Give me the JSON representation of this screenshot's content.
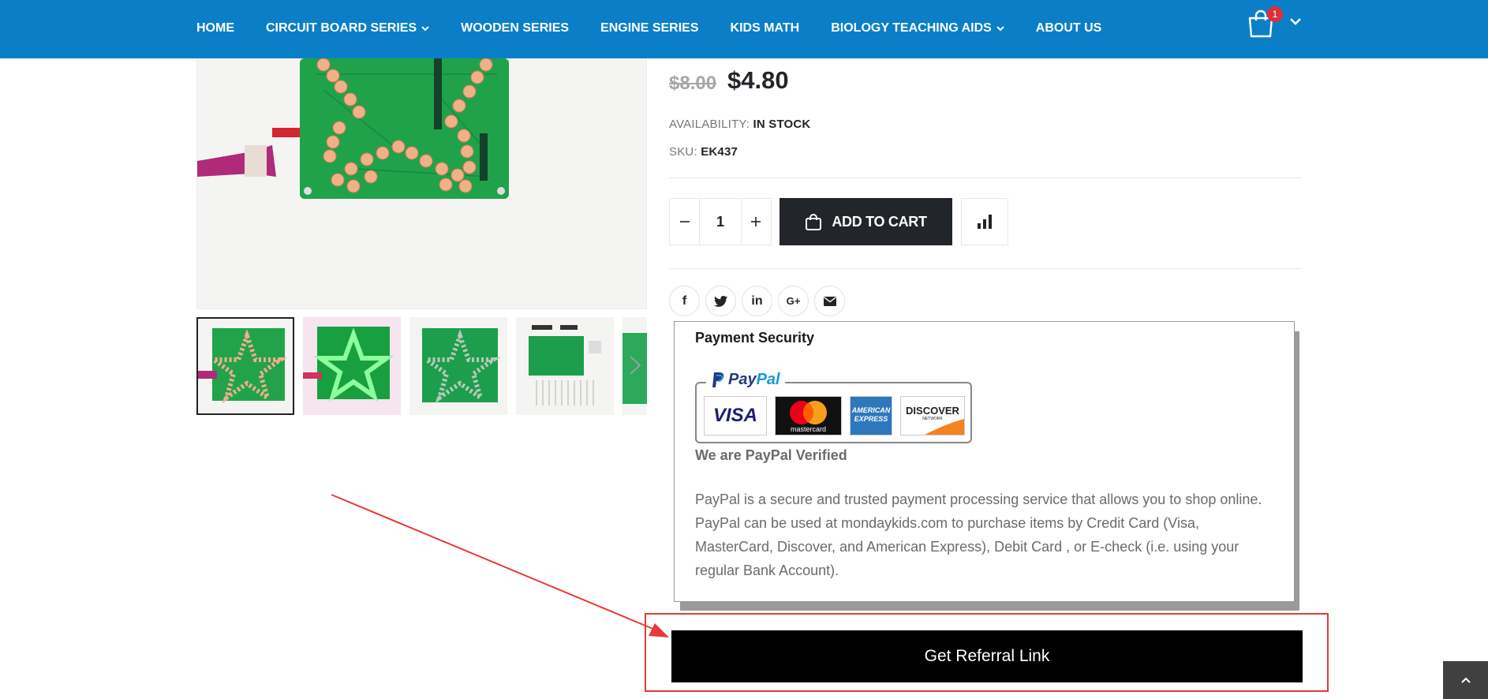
{
  "nav": {
    "items": [
      {
        "label": "HOME",
        "has_dropdown": false
      },
      {
        "label": "CIRCUIT BOARD SERIES",
        "has_dropdown": true
      },
      {
        "label": "WOODEN SERIES",
        "has_dropdown": false
      },
      {
        "label": "ENGINE SERIES",
        "has_dropdown": false
      },
      {
        "label": "KIDS MATH",
        "has_dropdown": false
      },
      {
        "label": "BIOLOGY TEACHING AIDS",
        "has_dropdown": true
      },
      {
        "label": "ABOUT US",
        "has_dropdown": false
      }
    ],
    "cart_count": "1"
  },
  "product": {
    "old_price": "$8.00",
    "price": "$4.80",
    "availability_label": "AVAILABILITY:",
    "availability_value": "IN STOCK",
    "sku_label": "SKU:",
    "sku_value": "EK437",
    "quantity": "1",
    "add_to_cart_label": "ADD TO CART"
  },
  "share": [
    {
      "name": "facebook",
      "glyph": "f"
    },
    {
      "name": "twitter",
      "glyph": "t"
    },
    {
      "name": "linkedin",
      "glyph": "in"
    },
    {
      "name": "google-plus",
      "glyph": "G+"
    },
    {
      "name": "email",
      "glyph": "✉"
    }
  ],
  "payment_security": {
    "title": "Payment Security",
    "paypal_logo_pay": "Pay",
    "paypal_logo_pal": "Pal",
    "cards": [
      "VISA",
      "mastercard",
      "AMERICAN EXPRESS",
      "DISCOVER"
    ],
    "discover_sub": "NETWORK",
    "verified": "We are PayPal Verified",
    "description": "PayPal is a secure and trusted payment processing service that allows you to shop online. PayPal can be used at mondaykids.com to purchase items by Credit Card (Visa, MasterCard, Discover, and American Express), Debit Card , or E-check (i.e. using your regular Bank Account)."
  },
  "referral": {
    "button_label": "Get Referral Link"
  },
  "colors": {
    "header": "#0a7fc8",
    "annotation": "#e5393a",
    "button_dark": "#222529"
  },
  "icons": [
    "cart-icon",
    "chevron-down-icon",
    "minus-icon",
    "plus-icon",
    "shopping-bag-icon",
    "bar-chart-icon",
    "chevron-right-icon",
    "chevron-up-icon"
  ]
}
